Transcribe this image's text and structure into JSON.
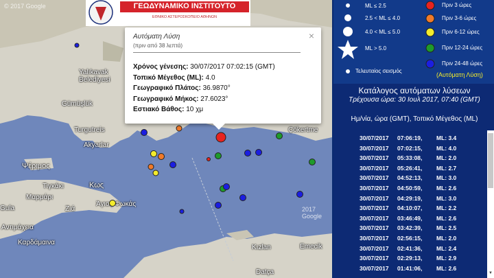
{
  "map": {
    "watermark_tl": "© 2017 Google",
    "watermark_br": "2017 Google",
    "places": [
      {
        "id": "yalikavak",
        "label": "Yalıkavak Belediyesi"
      },
      {
        "id": "gumuslik",
        "label": "Gümüşlük"
      },
      {
        "id": "turgutreis",
        "label": "Turgutreis"
      },
      {
        "id": "akyarlar",
        "label": "Akyarlar"
      },
      {
        "id": "psermos",
        "label": "Ψέριμος"
      },
      {
        "id": "tigkaki",
        "label": "Τιγκάκι"
      },
      {
        "id": "kos",
        "label": "Κως"
      },
      {
        "id": "marmari",
        "label": "Μαρμάρι"
      },
      {
        "id": "ziia",
        "label": "Ζιά"
      },
      {
        "id": "antimaxeia",
        "label": "Αντιμάχεια"
      },
      {
        "id": "kardamaina",
        "label": "Καρδάμαινα"
      },
      {
        "id": "ayios",
        "label": "Άγιος Φωκάς"
      },
      {
        "id": "cokertme",
        "label": "Çökertme"
      },
      {
        "id": "kizlan",
        "label": "Kızlan"
      },
      {
        "id": "emecik",
        "label": "Emecik"
      },
      {
        "id": "datca",
        "label": "Datça"
      },
      {
        "id": "gula",
        "label": "Gula"
      }
    ]
  },
  "logo": {
    "title": "ΓΕΩΔΥΝΑΜΙΚΟ ΙΝΣΤΙΤΟΥΤΟ",
    "subtitle": "ΕΘΝΙΚΟ ΑΣΤΕΡΟΣΚΟΠΕΙΟ ΑΘΗΝΩΝ"
  },
  "popup": {
    "title": "Αυτόματη Λύση",
    "subtitle": "(πριν από 38 λεπτά)",
    "close": "×",
    "rows": [
      {
        "label": "Χρόνος γένεσης:",
        "value": "30/07/2017  07:02:15 (GMT)"
      },
      {
        "label": "Τοπικό Μέγεθος (ML):",
        "value": "4.0"
      },
      {
        "label": "Γεωγραφικό Πλάτος:",
        "value": "36.9870°"
      },
      {
        "label": "Γεωγραφικό Μήκος:",
        "value": "27.6023°"
      },
      {
        "label": "Εστιακό Βάθος:",
        "value": "10 χμ"
      }
    ]
  },
  "legend": {
    "mag_items": [
      "ML ≤ 2.5",
      "2.5 < ML ≤ 4.0",
      "4.0 < ML ≤ 5.0",
      "ML > 5.0",
      "Τελευταίος σεισμός"
    ],
    "time_items": [
      {
        "label": "Πριν 3 ώρες",
        "color": "#e8231f"
      },
      {
        "label": "Πριν 3-6 ώρες",
        "color": "#f07a2a"
      },
      {
        "label": "Πριν 6-12 ώρες",
        "color": "#f4ec2c"
      },
      {
        "label": "Πριν 12-24 ώρες",
        "color": "#1e9a2b"
      },
      {
        "label": "Πριν 24-48 ώρες",
        "color": "#1b1ee0"
      }
    ],
    "auto_note": "(Αυτόματη Λύση)"
  },
  "catalog": {
    "title": "Κατάλογος αυτόματων λύσεων",
    "current_time": "Τρέχουσα ώρα: 30 Ιουλ 2017, 07:40 (GMT)",
    "header": "Ημ/νία, ώρα (GMT), Τοπικό Μέγεθος (ML)",
    "rows": [
      {
        "date": "30/07/2017",
        "time": "07:06:19,",
        "ml": "ML: 3.4"
      },
      {
        "date": "30/07/2017",
        "time": "07:02:15,",
        "ml": "ML: 4.0"
      },
      {
        "date": "30/07/2017",
        "time": "05:33:08,",
        "ml": "ML: 2.0"
      },
      {
        "date": "30/07/2017",
        "time": "05:26:41,",
        "ml": "ML: 2.7"
      },
      {
        "date": "30/07/2017",
        "time": "04:52:13,",
        "ml": "ML: 3.0"
      },
      {
        "date": "30/07/2017",
        "time": "04:50:59,",
        "ml": "ML: 2.6"
      },
      {
        "date": "30/07/2017",
        "time": "04:29:19,",
        "ml": "ML: 3.0"
      },
      {
        "date": "30/07/2017",
        "time": "04:10:07,",
        "ml": "ML: 2.2"
      },
      {
        "date": "30/07/2017",
        "time": "03:46:49,",
        "ml": "ML: 2.6"
      },
      {
        "date": "30/07/2017",
        "time": "03:42:39,",
        "ml": "ML: 2.5"
      },
      {
        "date": "30/07/2017",
        "time": "02:56:15,",
        "ml": "ML: 2.0"
      },
      {
        "date": "30/07/2017",
        "time": "02:41:36,",
        "ml": "ML: 2.4"
      },
      {
        "date": "30/07/2017",
        "time": "02:29:13,",
        "ml": "ML: 2.9"
      },
      {
        "date": "30/07/2017",
        "time": "01:41:06,",
        "ml": "ML: 2.6"
      }
    ]
  }
}
